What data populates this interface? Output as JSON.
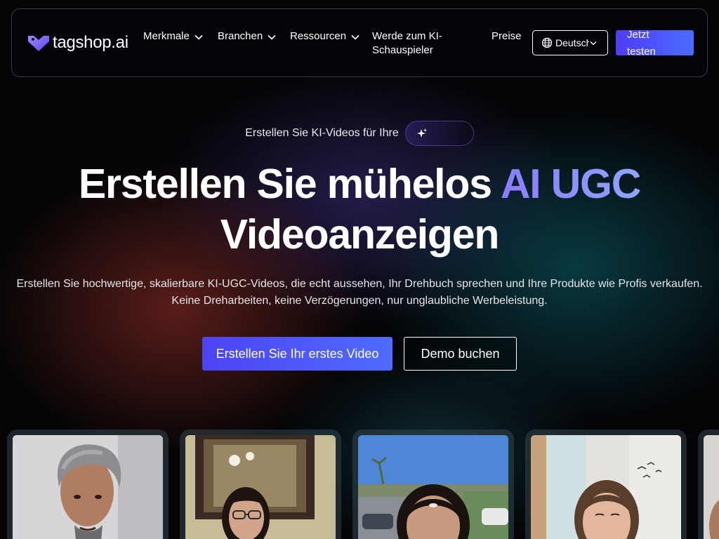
{
  "brand": {
    "name": "tagshop.ai",
    "accent": "#5b4df6",
    "accent_light": "#8a7cff"
  },
  "nav": {
    "items": [
      {
        "label": "Merkmale",
        "icon": "chevron-down-icon"
      },
      {
        "label": "Branchen",
        "icon": "chevron-down-icon"
      },
      {
        "label": "Ressourcen",
        "icon": "chevron-down-icon"
      },
      {
        "label": "Werde zum KI-Schauspieler"
      },
      {
        "label": "Preise"
      }
    ],
    "language": {
      "label": "Deutsch",
      "icon": "globe-icon"
    },
    "cta_label": "Jetzt testen"
  },
  "hero": {
    "eyebrow": "Erstellen Sie KI-Videos für Ihre",
    "eyebrow_icon": "sparkle-icon",
    "headline_part1": "Erstellen Sie mühelos ",
    "headline_accent": "AI UGC",
    "headline_part2": "Videoanzeigen",
    "subtitle": "Erstellen Sie hochwertige, skalierbare KI-UGC-Videos, die echt aussehen, Ihr Drehbuch sprechen und Ihre Produkte wie Profis verkaufen. Keine Dreharbeiten, keine Verzögerungen, nur unglaubliche Werbeleistung.",
    "primary_cta": "Erstellen Sie Ihr erstes Video",
    "secondary_cta": "Demo buchen"
  },
  "videos": {
    "cards": [
      {
        "subject": "man-grey-hair"
      },
      {
        "subject": "woman-glasses-indoor"
      },
      {
        "subject": "woman-outdoor-street"
      },
      {
        "subject": "woman-bright-room"
      },
      {
        "subject": "partial-card"
      }
    ]
  }
}
